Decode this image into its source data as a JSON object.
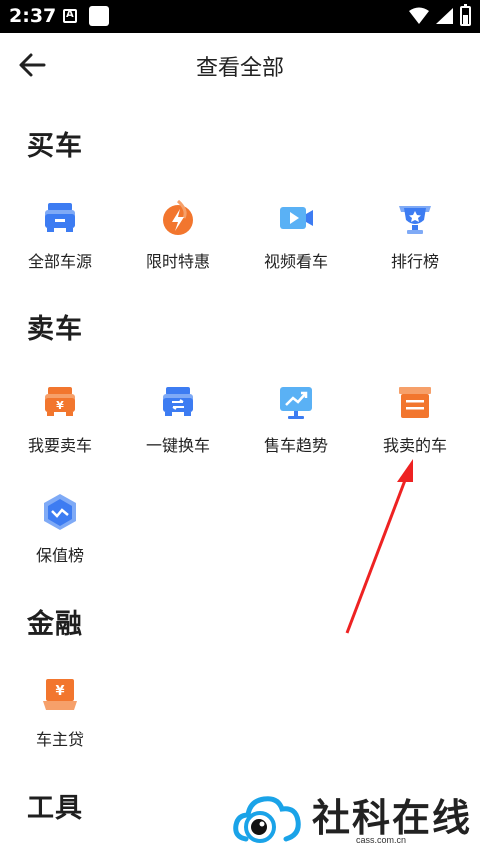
{
  "status_bar": {
    "time": "2:37",
    "notif_letter": "A"
  },
  "nav": {
    "title": "查看全部"
  },
  "sections": {
    "buy": {
      "title": "买车",
      "items": [
        "全部车源",
        "限时特惠",
        "视频看车",
        "排行榜"
      ]
    },
    "sell": {
      "title": "卖车",
      "items": [
        "我要卖车",
        "一键换车",
        "售车趋势",
        "我卖的车",
        "保值榜"
      ]
    },
    "finance": {
      "title": "金融",
      "items": [
        "车主贷"
      ]
    },
    "tools": {
      "title": "工具"
    }
  },
  "watermark": {
    "name": "社科在线",
    "url": "cass.com.cn"
  },
  "colors": {
    "accent_blue": "#3d7cf2",
    "accent_orange": "#f2762e",
    "arrow_red": "#ee2222"
  }
}
